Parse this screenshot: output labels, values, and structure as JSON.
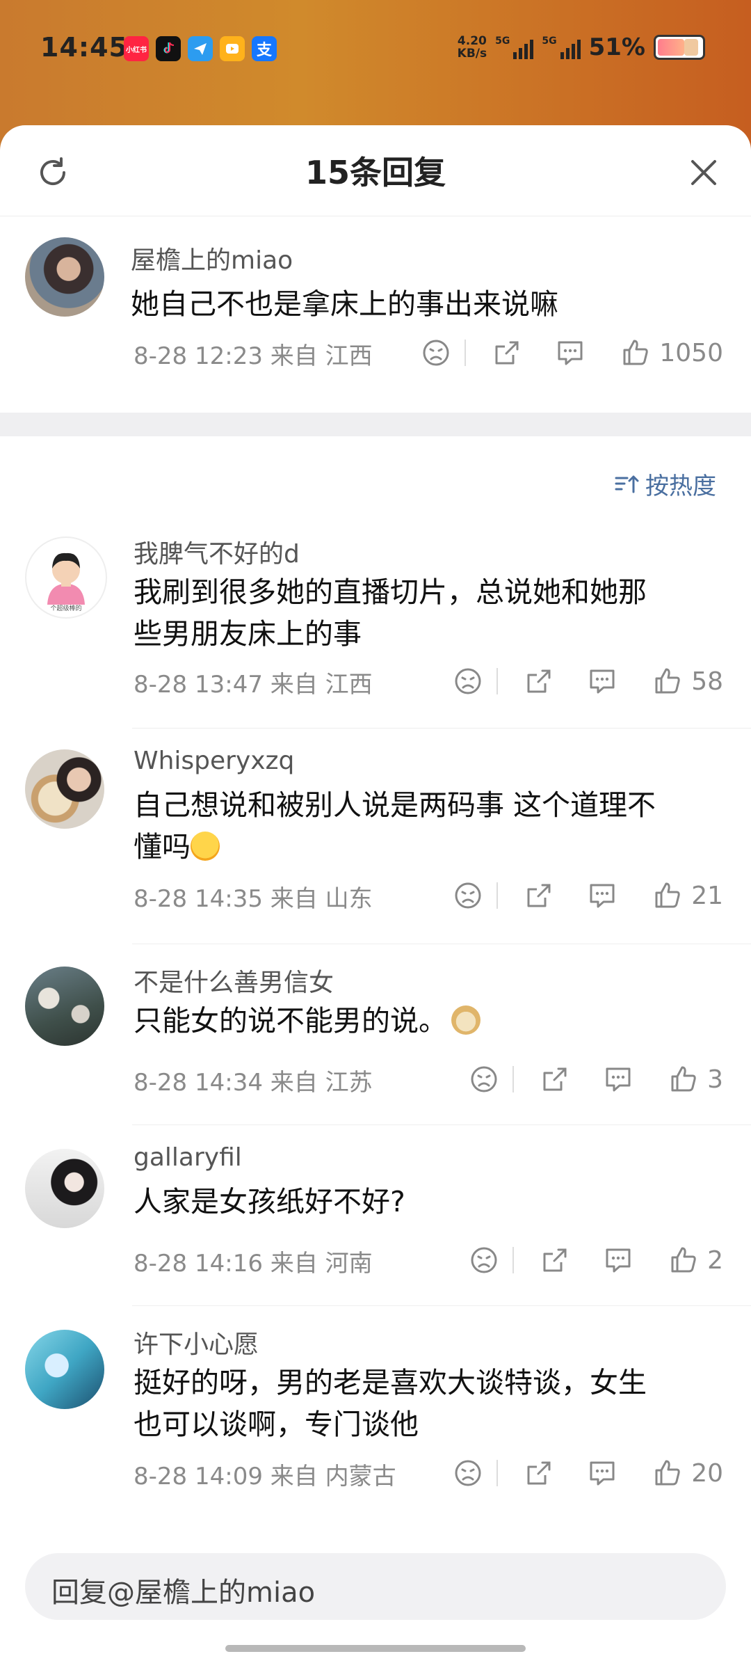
{
  "status_bar": {
    "time": "14:45",
    "net_speed_top": "4.20",
    "net_speed_bottom": "KB/s",
    "sig1_label": "5G",
    "sig2_label": "5G",
    "battery": "51%",
    "apps": [
      "小红书",
      "抖音",
      "飞",
      "视",
      "支"
    ]
  },
  "sheet": {
    "title": "15条回复",
    "refresh_icon": "refresh-icon",
    "close_icon": "close-icon"
  },
  "root": {
    "username": "屋檐上的miao",
    "text": "她自己不也是拿床上的事出来说嘛",
    "meta": "8-28 12:23  来自 江西",
    "likes": "1050"
  },
  "sort_label": "按热度",
  "replies": [
    {
      "username": "我脾气不好的d",
      "line1": "我刷到很多她的直播切片，总说她和她那",
      "line2": "些男朋友床上的事",
      "meta": "8-28 13:47  来自 江西",
      "likes": "58",
      "avatar_caption": "个超级棒的"
    },
    {
      "username": "Whisperyxzq",
      "line1": "自己想说和被别人说是两码事 这个道理不",
      "line2": "懂吗",
      "meta": "8-28 14:35  来自 山东",
      "likes": "21"
    },
    {
      "username": "不是什么善男信女",
      "line1": "只能女的说不能男的说。",
      "meta": "8-28 14:34  来自 江苏",
      "likes": "3"
    },
    {
      "username": "gallaryfil",
      "line1": "人家是女孩纸好不好?",
      "meta": "8-28 14:16  来自 河南",
      "likes": "2"
    },
    {
      "username": "许下小心愿",
      "line1": "挺好的呀，男的老是喜欢大谈特谈，女生",
      "line2": "也可以谈啊，专门谈他",
      "meta": "8-28 14:09  来自 内蒙古",
      "likes": "20"
    }
  ],
  "input_placeholder": "回复@屋檐上的miao",
  "colors": {
    "accent": "#4a6fa0",
    "meta_gray": "#8a8a8a"
  }
}
